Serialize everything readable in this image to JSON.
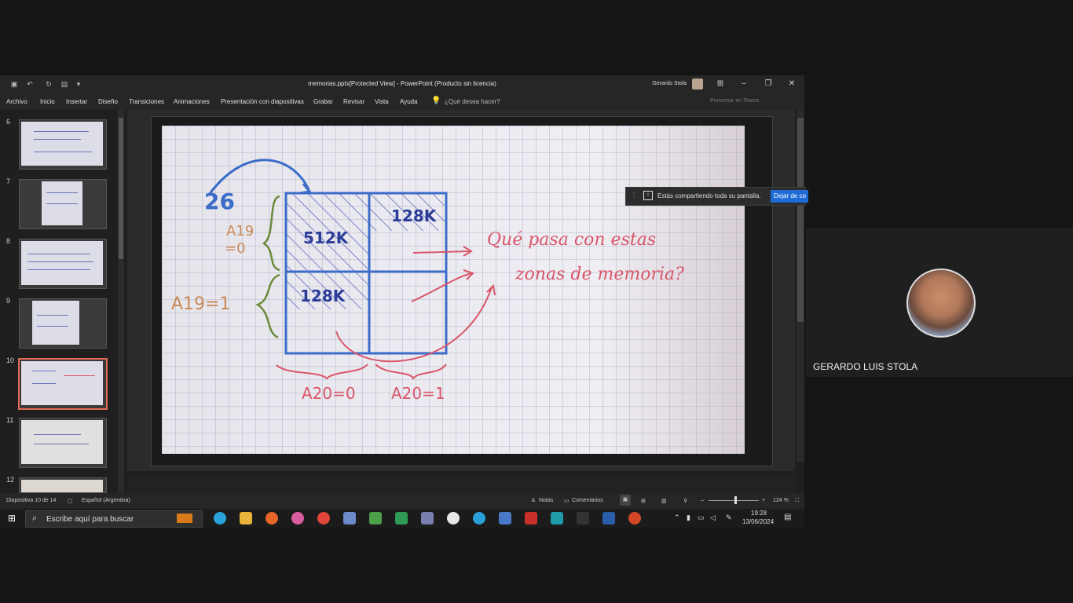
{
  "window": {
    "title": "memorias.pptx[Protected View] - PowerPoint (Producto sin licencia)",
    "user": "Gerardo Stola"
  },
  "ribbon": {
    "tabs": [
      "Archivo",
      "Inicio",
      "Insertar",
      "Diseño",
      "Transiciones",
      "Animaciones",
      "Presentación con diapositivas",
      "Grabar",
      "Revisar",
      "Vista",
      "Ayuda"
    ],
    "tell_me": "¿Qué desea hacer?",
    "teams": "Presentar en Teams"
  },
  "thumbnails": {
    "numbers": [
      "6",
      "7",
      "8",
      "9",
      "10",
      "11",
      "12"
    ],
    "selected": "10"
  },
  "slide": {
    "handwritten": {
      "value_26": "26",
      "a19_0_a": "A19",
      "a19_0_b": "=0",
      "a19_1": "A19=1",
      "block_512k": "512K",
      "block_128k_top": "128K",
      "block_128k_bottom": "128K",
      "question_line1": "Qué pasa con estas",
      "question_line2": "zonas de memoria?",
      "a20_0": "A20=0",
      "a20_1": "A20=1"
    }
  },
  "share_banner": {
    "text": "Estás compartiendo toda su pantalla.",
    "button": "Dejar de co"
  },
  "statusbar": {
    "slide_counter": "Diapositiva 10 de 14",
    "language": "Español (Argentina)",
    "notes": "Notas",
    "comments": "Comentarios",
    "zoom": "124 %"
  },
  "taskbar": {
    "search_placeholder": "Escribe aquí para buscar",
    "time": "19:28",
    "date": "13/06/2024"
  },
  "participant": {
    "name": "GERARDO LUIS STOLA"
  },
  "colors": {
    "accent_red": "#e06a54",
    "share_button": "#1f6bd6",
    "ink_blue": "#3a6cc8",
    "ink_red": "#d9566a"
  }
}
